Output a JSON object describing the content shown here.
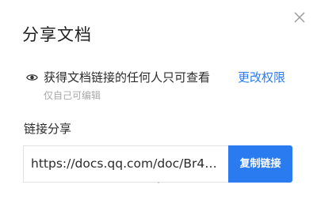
{
  "dialog": {
    "title": "分享文档",
    "close_icon": "close-icon"
  },
  "permission": {
    "icon": "eye-icon",
    "text": "获得文档链接的任何人只可查看",
    "change_link": "更改权限",
    "subtext": "仅自己可编辑"
  },
  "share": {
    "label": "链接分享",
    "url": "https://docs.qq.com/doc/Br4…",
    "copy_button": "复制链接"
  },
  "colors": {
    "accent": "#2a7bf0",
    "text": "#2b2b2b",
    "muted": "#a8a8a8"
  }
}
